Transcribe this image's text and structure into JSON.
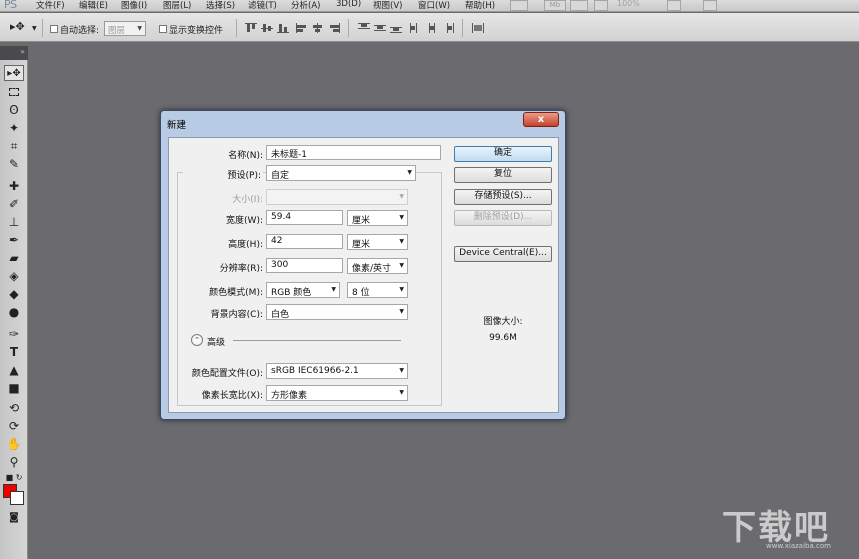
{
  "app": {
    "logo": "PS"
  },
  "menu": {
    "items": [
      "文件(F)",
      "编辑(E)",
      "图像(I)",
      "图层(L)",
      "选择(S)",
      "滤镜(T)",
      "分析(A)",
      "3D(D)",
      "视图(V)",
      "窗口(W)",
      "帮助(H)"
    ],
    "mb_label": "Mb",
    "zoom": "100%"
  },
  "options": {
    "move_icon": "move-tool-icon",
    "auto_select_label": "自动选择:",
    "auto_select_value": "图层",
    "show_transform_label": "显示变换控件"
  },
  "tools": [
    "move",
    "marquee",
    "lasso",
    "quick-select",
    "crop",
    "eyedropper",
    "healing",
    "brush",
    "clone-stamp",
    "history-brush",
    "eraser",
    "paint-bucket",
    "blur",
    "dodge",
    "pen",
    "type",
    "path-select",
    "shape",
    "3d-rotate",
    "3d-orbit",
    "hand",
    "zoom"
  ],
  "colors": {
    "foreground": "#ee0000",
    "background": "#ffffff"
  },
  "dialog": {
    "title": "新建",
    "close": "x",
    "name_label": "名称(N):",
    "name_value": "未标题-1",
    "preset_label": "预设(P):",
    "preset_value": "自定",
    "size_label": "大小(I):",
    "width_label": "宽度(W):",
    "width_value": "59.4",
    "width_unit": "厘米",
    "height_label": "高度(H):",
    "height_value": "42",
    "height_unit": "厘米",
    "resolution_label": "分辨率(R):",
    "resolution_value": "300",
    "resolution_unit": "像素/英寸",
    "color_mode_label": "颜色模式(M):",
    "color_mode_value": "RGB 颜色",
    "bit_depth_value": "8 位",
    "bg_content_label": "背景内容(C):",
    "bg_content_value": "白色",
    "advanced_label": "高级",
    "color_profile_label": "颜色配置文件(O):",
    "color_profile_value": "sRGB IEC61966-2.1",
    "pixel_aspect_label": "像素长宽比(X):",
    "pixel_aspect_value": "方形像素",
    "buttons": {
      "ok": "确定",
      "reset": "复位",
      "save_preset": "存储预设(S)...",
      "delete_preset": "删除预设(D)...",
      "device_central": "Device Central(E)..."
    },
    "image_size_label": "图像大小:",
    "image_size_value": "99.6M"
  },
  "watermark": {
    "text": "下载吧",
    "url": "www.xiazaiba.com"
  }
}
